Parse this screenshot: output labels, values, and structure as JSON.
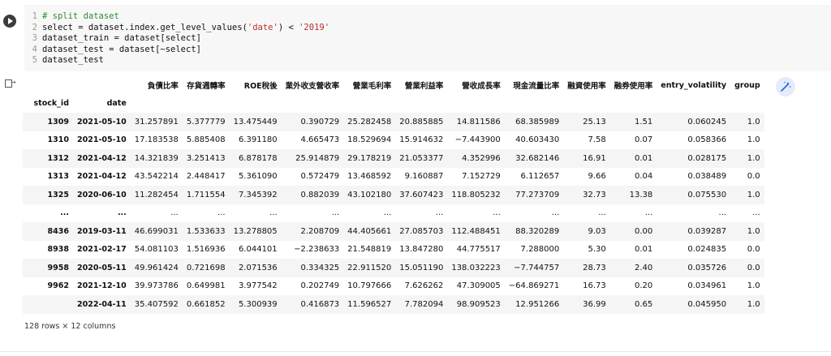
{
  "code": {
    "lines": [
      {
        "num": "1",
        "text": "",
        "comment": "# split dataset"
      },
      {
        "num": "2",
        "pre": "select = dataset.index.get_level_values(",
        "str1": "'date'",
        "mid": ") < ",
        "str2": "'2019'",
        "post": ""
      },
      {
        "num": "3",
        "text": "dataset_train = dataset[select]"
      },
      {
        "num": "4",
        "text": "dataset_test = dataset[~select]"
      },
      {
        "num": "5",
        "text": "dataset_test"
      }
    ]
  },
  "icons": {
    "run": "play-icon",
    "output": "output-icon",
    "magic": "magic-wand-icon"
  },
  "table": {
    "columns": [
      "負債比率",
      "存貨週轉率",
      "ROE稅後",
      "業外收支營收率",
      "營業毛利率",
      "營業利益率",
      "營收成長率",
      "現金流量比率",
      "融資使用率",
      "融券使用率",
      "entry_volatility",
      "group"
    ],
    "index_names": [
      "stock_id",
      "date"
    ],
    "rows": [
      {
        "id": "1309",
        "date": "2021-05-10",
        "cells": [
          "31.257891",
          "5.377779",
          "13.475449",
          "0.390729",
          "25.282458",
          "20.885885",
          "14.811586",
          "68.385989",
          "25.13",
          "1.51",
          "0.060245",
          "1.0"
        ]
      },
      {
        "id": "1310",
        "date": "2021-05-10",
        "cells": [
          "17.183538",
          "5.885408",
          "6.391180",
          "4.665473",
          "18.529694",
          "15.914632",
          "−7.443900",
          "40.603430",
          "7.58",
          "0.07",
          "0.058366",
          "1.0"
        ]
      },
      {
        "id": "1312",
        "date": "2021-04-12",
        "cells": [
          "14.321839",
          "3.251413",
          "6.878178",
          "25.914879",
          "29.178219",
          "21.053377",
          "4.352996",
          "32.682146",
          "16.91",
          "0.01",
          "0.028175",
          "1.0"
        ]
      },
      {
        "id": "1313",
        "date": "2021-04-12",
        "cells": [
          "43.542214",
          "2.448417",
          "5.361090",
          "0.572479",
          "13.468592",
          "9.160887",
          "7.152729",
          "6.112657",
          "9.66",
          "0.04",
          "0.038489",
          "0.0"
        ]
      },
      {
        "id": "1325",
        "date": "2020-06-10",
        "cells": [
          "11.282454",
          "1.711554",
          "7.345392",
          "0.882039",
          "43.102180",
          "37.607423",
          "118.805232",
          "77.273709",
          "32.73",
          "13.38",
          "0.075530",
          "1.0"
        ]
      },
      {
        "id": "...",
        "date": "...",
        "cells": [
          "...",
          "...",
          "...",
          "...",
          "...",
          "...",
          "...",
          "...",
          "...",
          "...",
          "...",
          "..."
        ]
      },
      {
        "id": "8436",
        "date": "2019-03-11",
        "cells": [
          "46.699031",
          "1.533633",
          "13.278805",
          "2.208709",
          "44.405661",
          "27.085703",
          "112.488451",
          "88.320289",
          "9.03",
          "0.00",
          "0.039287",
          "1.0"
        ]
      },
      {
        "id": "8938",
        "date": "2021-02-17",
        "cells": [
          "54.081103",
          "1.516936",
          "6.044101",
          "−2.238633",
          "21.548819",
          "13.847280",
          "44.775517",
          "7.288000",
          "5.30",
          "0.01",
          "0.024835",
          "0.0"
        ]
      },
      {
        "id": "9958",
        "date": "2020-05-11",
        "cells": [
          "49.961424",
          "0.721698",
          "2.071536",
          "0.334325",
          "22.911520",
          "15.051190",
          "138.032223",
          "−7.744757",
          "28.73",
          "2.40",
          "0.035726",
          "0.0"
        ]
      },
      {
        "id": "9962",
        "date": "2021-12-10",
        "cells": [
          "39.973786",
          "0.649981",
          "3.977542",
          "0.202749",
          "10.797666",
          "7.626262",
          "47.309005",
          "−64.869271",
          "16.73",
          "0.20",
          "0.034961",
          "1.0"
        ]
      },
      {
        "id": "",
        "date": "2022-04-11",
        "cells": [
          "35.407592",
          "0.661852",
          "5.300939",
          "0.416873",
          "11.596527",
          "7.782094",
          "98.909523",
          "12.951266",
          "36.99",
          "0.65",
          "0.045950",
          "1.0"
        ]
      }
    ],
    "shape_note": "128 rows × 12 columns"
  }
}
